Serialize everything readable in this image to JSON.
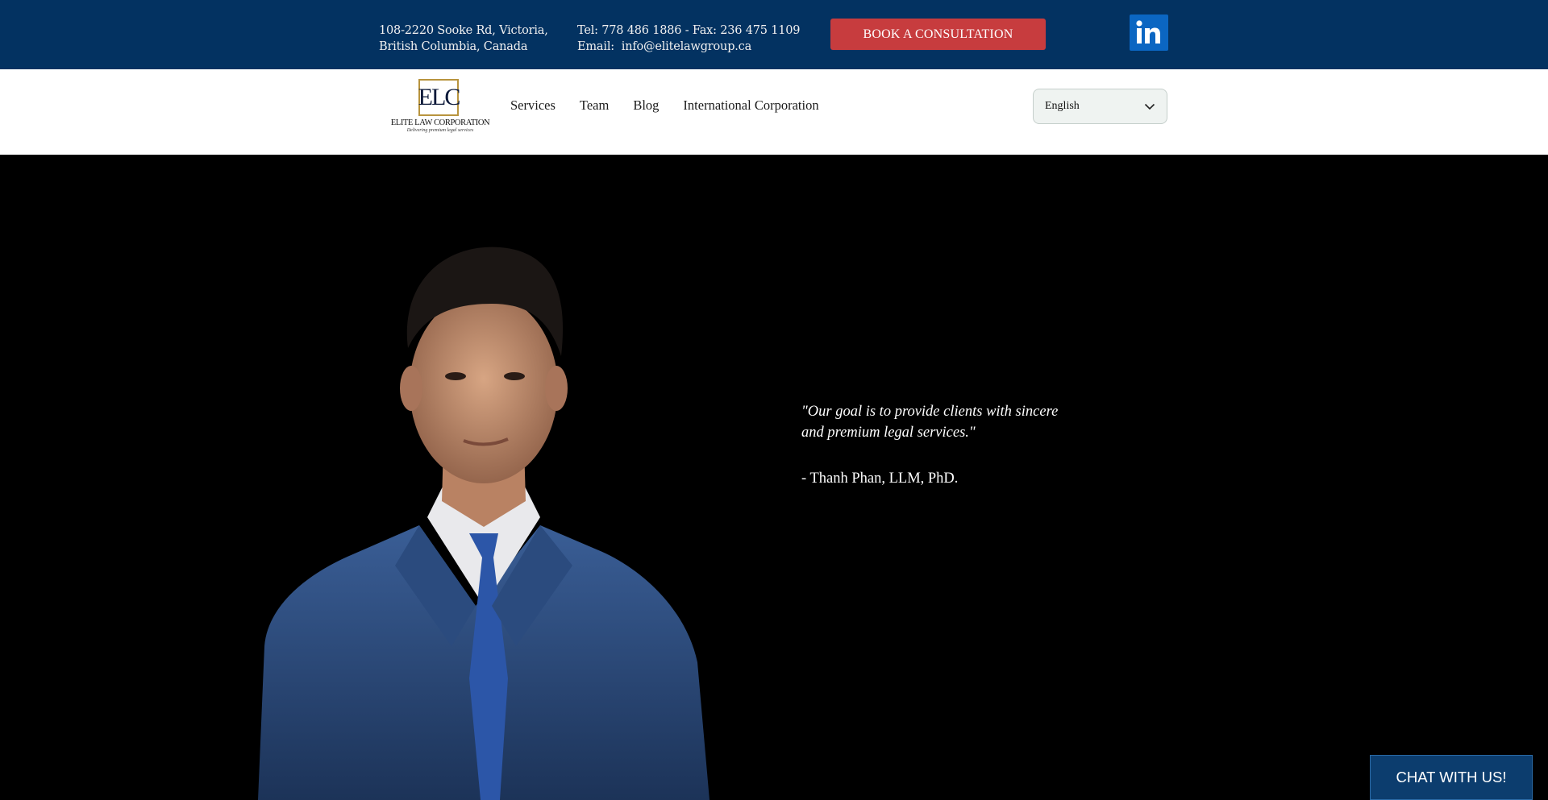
{
  "topbar": {
    "address_line1": "108-2220 Sooke Rd, Victoria,",
    "address_line2": "British Columbia, Canada",
    "phone_line": "Tel: 778 486 1886 - Fax: 236 475 1109",
    "email_label": "Email:",
    "email": "info@elitelawgroup.ca",
    "cta_label": "BOOK A CONSULTATION",
    "social_icon": "linkedin-icon",
    "colors": {
      "bar": "#033261",
      "cta": "#c73c3e",
      "linkedin": "#0b66c2"
    }
  },
  "header": {
    "logo": {
      "letters": "ELC",
      "name": "ELITE LAW CORPORATION",
      "tagline": "Delivering premium legal services"
    },
    "nav": [
      "Services",
      "Team",
      "Blog",
      "International Corporation"
    ],
    "language": {
      "selected": "English",
      "icon": "chevron-down-icon"
    }
  },
  "hero": {
    "quote": "\"Our goal is to provide clients with sincere and premium legal services.\"",
    "author": "- Thanh Phan, LLM, PhD.",
    "image": "portrait-photo"
  },
  "chat": {
    "label": "CHAT WITH US!"
  }
}
